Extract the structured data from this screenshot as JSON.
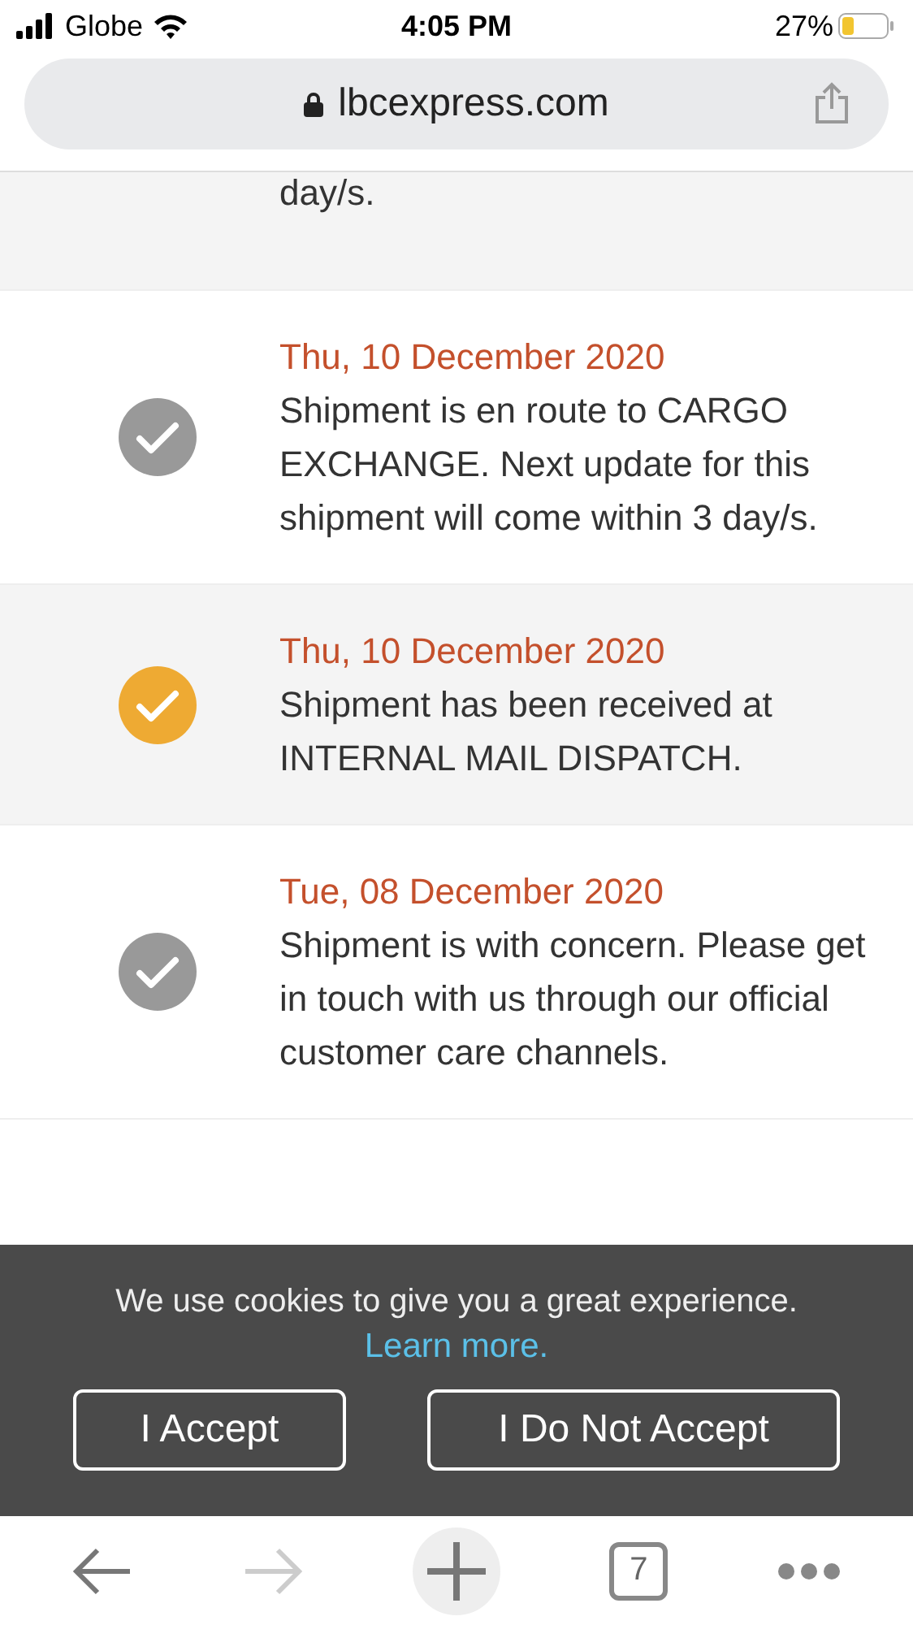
{
  "status_bar": {
    "carrier": "Globe",
    "time": "4:05 PM",
    "battery": "27%"
  },
  "address_bar": {
    "url": "lbcexpress.com"
  },
  "events": [
    {
      "text": "day/s."
    },
    {
      "date": "Thu, 10 December 2020",
      "text": "Shipment is en route to CARGO EXCHANGE. Next update for this shipment will come within 3 day/s.",
      "current": false
    },
    {
      "date": "Thu, 10 December 2020",
      "text": "Shipment has been received at INTERNAL MAIL DISPATCH.",
      "current": true
    },
    {
      "date": "Tue, 08 December 2020",
      "text": "Shipment is with concern. Please get in touch with us through our official customer care channels.",
      "current": false
    }
  ],
  "cookie_banner": {
    "message": "We use cookies to give you a great experience.",
    "link": "Learn more.",
    "buttons": [
      "I Accept",
      "I Do Not Accept"
    ]
  },
  "toolbar": {
    "tab_count": "7"
  }
}
